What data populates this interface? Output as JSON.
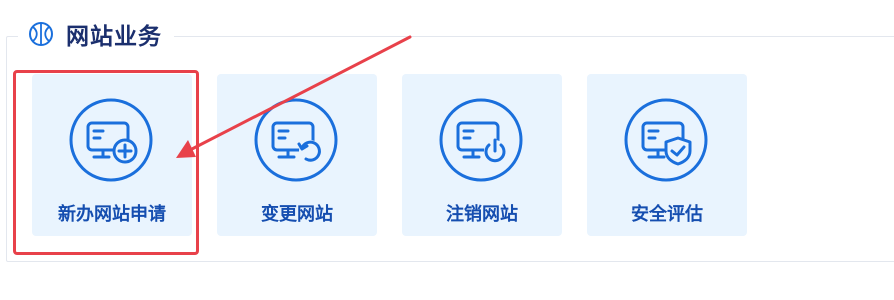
{
  "section": {
    "title": "网站业务",
    "icon": "basketball-icon"
  },
  "cards": [
    {
      "label": "新办网站申请",
      "icon": "monitor-add-icon"
    },
    {
      "label": "变更网站",
      "icon": "monitor-refresh-icon"
    },
    {
      "label": "注销网站",
      "icon": "monitor-power-icon"
    },
    {
      "label": "安全评估",
      "icon": "monitor-shield-icon"
    }
  ],
  "colors": {
    "accent": "#1a6fdc",
    "card_background": "#e9f4fe",
    "title": "#1b2f6e",
    "highlight": "#e8414a"
  }
}
